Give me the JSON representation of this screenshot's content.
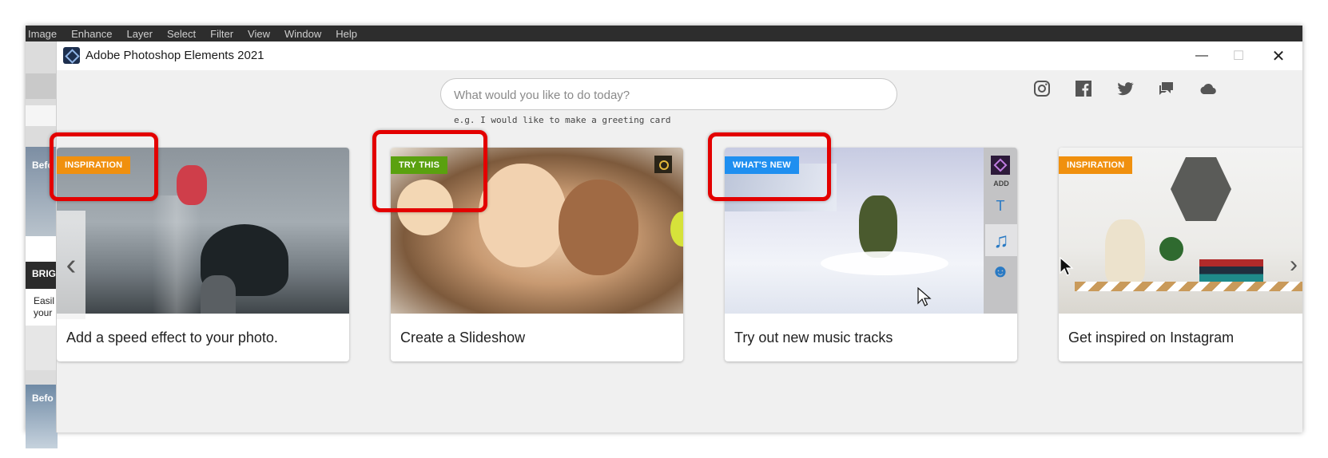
{
  "background_app": {
    "menu": [
      "Image",
      "Enhance",
      "Layer",
      "Select",
      "Filter",
      "View",
      "Window",
      "Help"
    ],
    "strip": {
      "before_label_1": "Befo",
      "section_title": "BRIG",
      "section_text_1": "Easil",
      "section_text_2": "your",
      "before_label_2": "Befo"
    }
  },
  "window": {
    "title": "Adobe Photoshop Elements 2021",
    "minimize": "—",
    "maximize": "☐",
    "close": "✕"
  },
  "search": {
    "placeholder": "What would you like to do today?",
    "hint": "e.g. I would like to make a greeting card"
  },
  "social": [
    "instagram-icon",
    "facebook-icon",
    "twitter-icon",
    "community-chat-icon",
    "cloud-icon"
  ],
  "cards": [
    {
      "tag": "INSPIRATION",
      "tag_color": "#f0900e",
      "caption": "Add a speed effect to your photo."
    },
    {
      "tag": "TRY THIS",
      "tag_color": "#5aa10f",
      "caption": "Create a Slideshow"
    },
    {
      "tag": "WHAT'S NEW",
      "tag_color": "#1f8ff0",
      "caption": "Try out new music tracks",
      "panel_add_label": "ADD"
    },
    {
      "tag": "INSPIRATION",
      "tag_color": "#f0900e",
      "caption": "Get inspired on Instagram"
    }
  ],
  "carousel": {
    "prev": "‹",
    "next": "›"
  },
  "colors": {
    "highlight": "#e30000",
    "window_bg": "#f0f0f0"
  }
}
